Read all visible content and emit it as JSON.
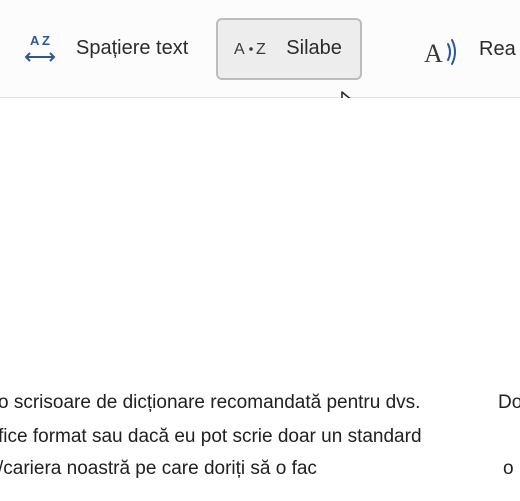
{
  "toolbar": {
    "text_spacing_label": "Spațiere text",
    "syllables_label": "Silabe",
    "read_aloud_label_fragment": "Rea"
  },
  "icons": {
    "spacing": "spacing-icon",
    "syllables": "syllables-icon",
    "read_aloud": "read-aloud-icon"
  },
  "document": {
    "left_lines": [
      "o scrisoare de dicționare recomandată pentru dvs.",
      "fice format sau dacă eu pot scrie doar un standard",
      "/cariera noastră pe care doriți să o fac"
    ],
    "right_fragments": {
      "line1": "Do",
      "line3": "o"
    }
  }
}
